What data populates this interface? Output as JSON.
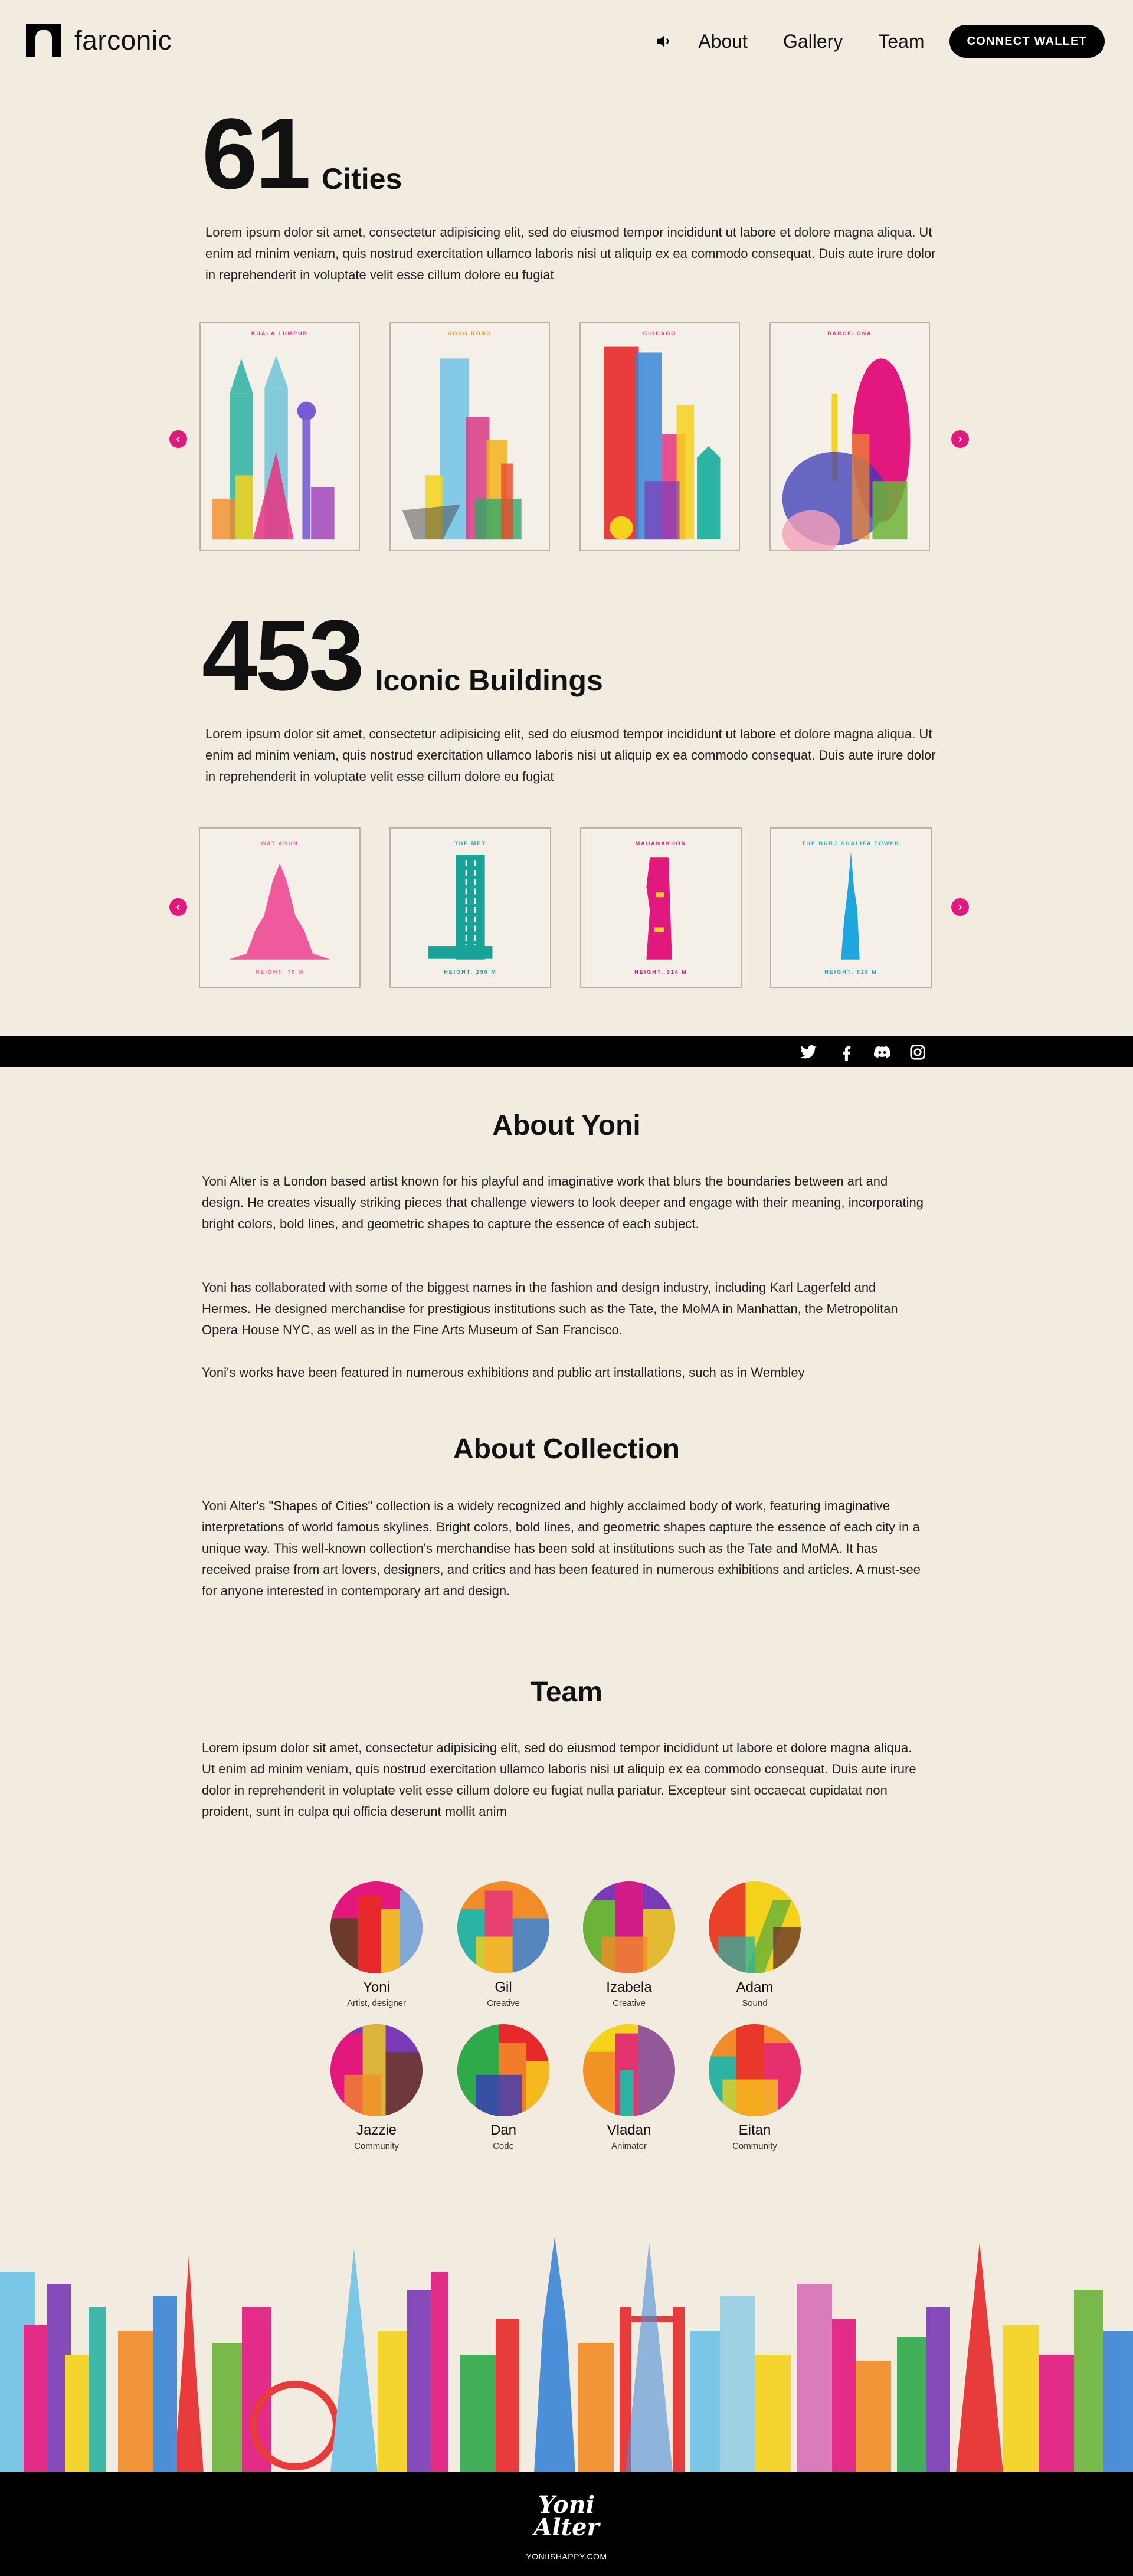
{
  "header": {
    "logo_text": "farconic",
    "nav": [
      "About",
      "Gallery",
      "Team"
    ],
    "connect_label": "CONNECT WALLET"
  },
  "cities": {
    "count": "61",
    "label": "Cities",
    "text": "Lorem ipsum dolor sit amet, consectetur adipisicing elit, sed do eiusmod tempor incididunt ut labore et dolore magna aliqua. Ut enim ad minim veniam, quis nostrud exercitation ullamco laboris nisi ut aliquip ex ea commodo consequat. Duis aute irure dolor in reprehenderit in voluptate velit esse cillum dolore eu fugiat",
    "cards": [
      {
        "title": "KUALA LUMPUR"
      },
      {
        "title": "HONG KONG"
      },
      {
        "title": "CHICAGO"
      },
      {
        "title": "BARCELONA"
      }
    ]
  },
  "buildings": {
    "count": "453",
    "label": "Iconic Buildings",
    "text": "Lorem ipsum dolor sit amet, consectetur adipisicing elit, sed do eiusmod tempor incididunt ut labore et dolore magna aliqua. Ut enim ad minim veniam, quis nostrud exercitation ullamco laboris nisi ut aliquip ex ea commodo consequat. Duis aute irure dolor in reprehenderit in voluptate velit esse cillum dolore eu fugiat",
    "cards": [
      {
        "title": "WAT ARUN",
        "footer": "HEIGHT: 79 M",
        "color": "#ee5a9c"
      },
      {
        "title": "THE MET",
        "footer": "HEIGHT: 250 M",
        "color": "#18a39a"
      },
      {
        "title": "MAHANAKHON",
        "footer": "HEIGHT: 314 M",
        "color": "#e2187f"
      },
      {
        "title": "THE BURJ KHALIFA TOWER",
        "footer": "HEIGHT: 828 M",
        "color": "#1ea7df"
      }
    ]
  },
  "about_yoni": {
    "title": "About Yoni",
    "p1": "Yoni Alter is a London based artist known for his playful and imaginative work that blurs the boundaries between art and design. He creates visually striking pieces that challenge viewers to look deeper and engage with their meaning, incorporating bright colors, bold lines, and geometric shapes to capture the essence of each subject.",
    "p2": "Yoni has collaborated with some of the biggest names in the fashion and design industry, including Karl Lagerfeld and Hermes. He designed merchandise for prestigious institutions such as the Tate, the MoMA in Manhattan, the Metropolitan Opera House NYC, as well as in the Fine Arts Museum of San Francisco.",
    "p3": "Yoni's works have been featured in numerous exhibitions and public art installations, such as in Wembley"
  },
  "about_collection": {
    "title": "About Collection",
    "p1": "Yoni Alter's \"Shapes of Cities\" collection is a widely recognized and highly acclaimed body of work, featuring imaginative interpretations of world famous skylines. Bright colors, bold lines, and geometric shapes capture the essence of each city in a unique way. This well-known collection's merchandise has been sold at institutions such as the Tate and MoMA. It has received praise from art lovers, designers, and critics and has been featured in numerous exhibitions and articles. A must-see for anyone interested in contemporary art and design."
  },
  "team": {
    "title": "Team",
    "text": "Lorem ipsum dolor sit amet, consectetur adipisicing elit, sed do eiusmod tempor incididunt ut labore et dolore magna aliqua. Ut enim ad minim veniam, quis nostrud exercitation ullamco laboris nisi ut aliquip ex ea commodo consequat. Duis aute irure dolor in reprehenderit in voluptate velit esse cillum dolore eu fugiat nulla pariatur. Excepteur sint occaecat cupidatat non proident, sunt in culpa qui officia deserunt mollit anim",
    "members": [
      {
        "name": "Yoni",
        "role": "Artist, designer"
      },
      {
        "name": "Gil",
        "role": "Creative"
      },
      {
        "name": "Izabela",
        "role": "Creative"
      },
      {
        "name": "Adam",
        "role": "Sound"
      },
      {
        "name": "Jazzie",
        "role": "Community"
      },
      {
        "name": "Dan",
        "role": "Code"
      },
      {
        "name": "Vladan",
        "role": "Animator"
      },
      {
        "name": "Eitan",
        "role": "Community"
      }
    ]
  },
  "social": [
    "twitter-icon",
    "facebook-icon",
    "discord-icon",
    "instagram-icon"
  ],
  "footer": {
    "signature_line1": "Yoni",
    "signature_line2": "Alter",
    "site": "YONIISHAPPY.COM"
  }
}
